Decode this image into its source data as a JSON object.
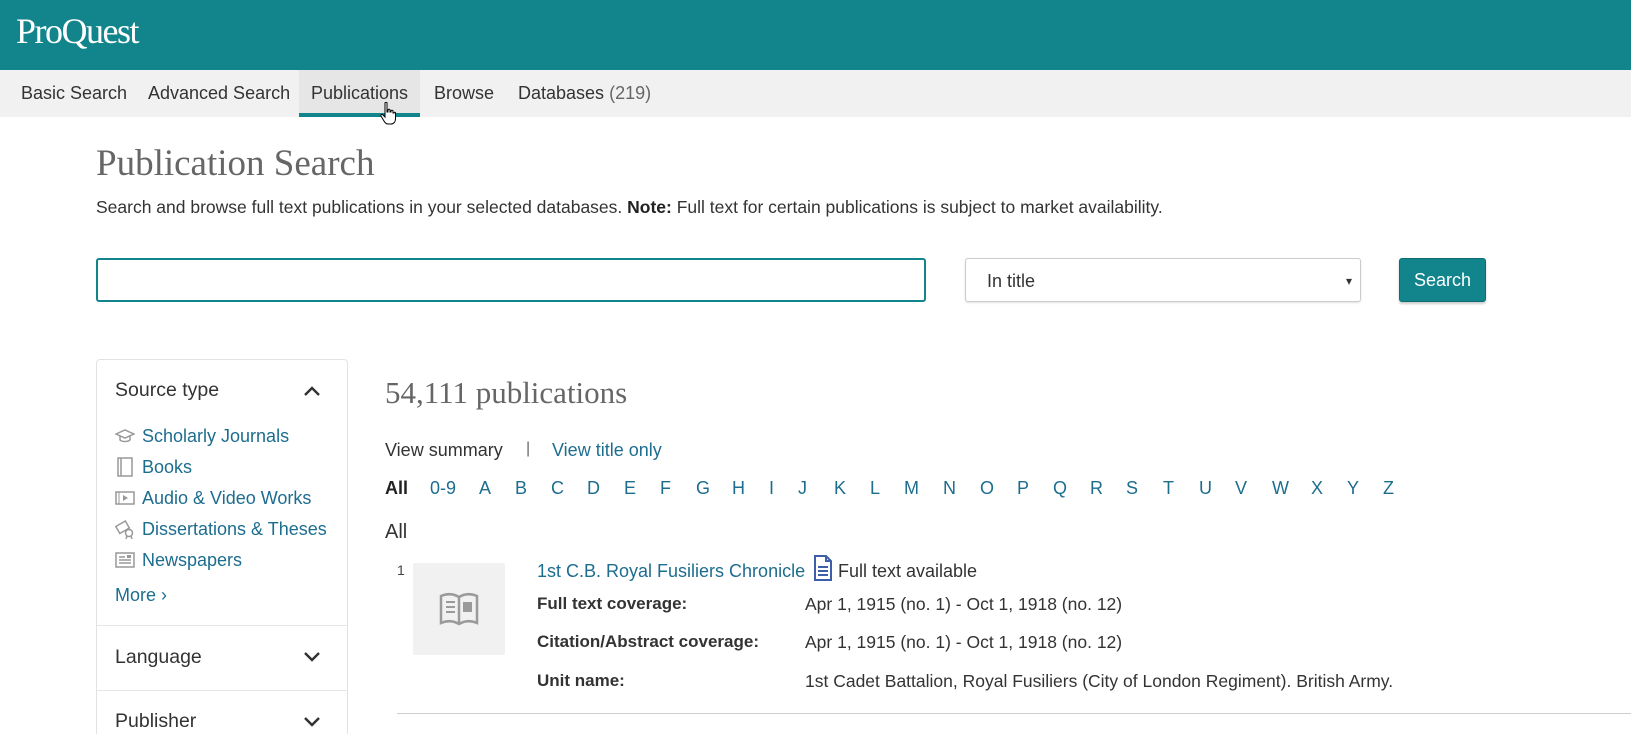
{
  "header": {
    "logo_text": "ProQuest",
    "brand_color": "#12858c"
  },
  "nav": {
    "tabs": [
      {
        "label": "Basic Search"
      },
      {
        "label": "Advanced Search"
      },
      {
        "label": "Publications",
        "active": true
      },
      {
        "label": "Browse"
      },
      {
        "label": "Databases",
        "count": "(219)"
      }
    ]
  },
  "main": {
    "title": "Publication Search",
    "description_text": "Search and browse full text publications in your selected databases. ",
    "description_note_label": "Note:",
    "description_note_text": " Full text for certain publications is subject to market availability.",
    "search": {
      "value": "",
      "placeholder": "",
      "scope_selected": "In title",
      "button_label": "Search"
    }
  },
  "sidebar": {
    "source_type": {
      "title": "Source type",
      "items": [
        {
          "label": "Scholarly Journals",
          "icon": "mortarboard-icon"
        },
        {
          "label": "Books",
          "icon": "book-icon"
        },
        {
          "label": "Audio & Video Works",
          "icon": "film-icon"
        },
        {
          "label": "Dissertations & Theses",
          "icon": "diploma-icon"
        },
        {
          "label": "Newspapers",
          "icon": "newspaper-icon"
        }
      ],
      "more_label": "More ›"
    },
    "language": {
      "title": "Language"
    },
    "publisher": {
      "title": "Publisher"
    }
  },
  "results": {
    "count_text": "54,111 publications",
    "view_summary": "View summary",
    "separator": "|",
    "view_title_only": "View title only",
    "alphabet": [
      "All",
      "0-9",
      "A",
      "B",
      "C",
      "D",
      "E",
      "F",
      "G",
      "H",
      "I",
      "J",
      "K",
      "L",
      "M",
      "N",
      "O",
      "P",
      "Q",
      "R",
      "S",
      "T",
      "U",
      "V",
      "W",
      "X",
      "Y",
      "Z"
    ],
    "alphabet_selected": "All",
    "section_letter": "All",
    "items": [
      {
        "number": "1",
        "title": "1st C.B. Royal Fusiliers Chronicle",
        "full_text_label": "Full text available",
        "fields": [
          {
            "label": "Full text coverage:",
            "value": "Apr 1, 1915 (no. 1) - Oct 1, 1918 (no. 12)"
          },
          {
            "label": "Citation/Abstract coverage:",
            "value": "Apr 1, 1915 (no. 1) - Oct 1, 1918 (no. 12)"
          },
          {
            "label": "Unit name:",
            "value": "1st Cadet Battalion, Royal Fusiliers (City of London Regiment). British Army."
          }
        ]
      }
    ]
  }
}
